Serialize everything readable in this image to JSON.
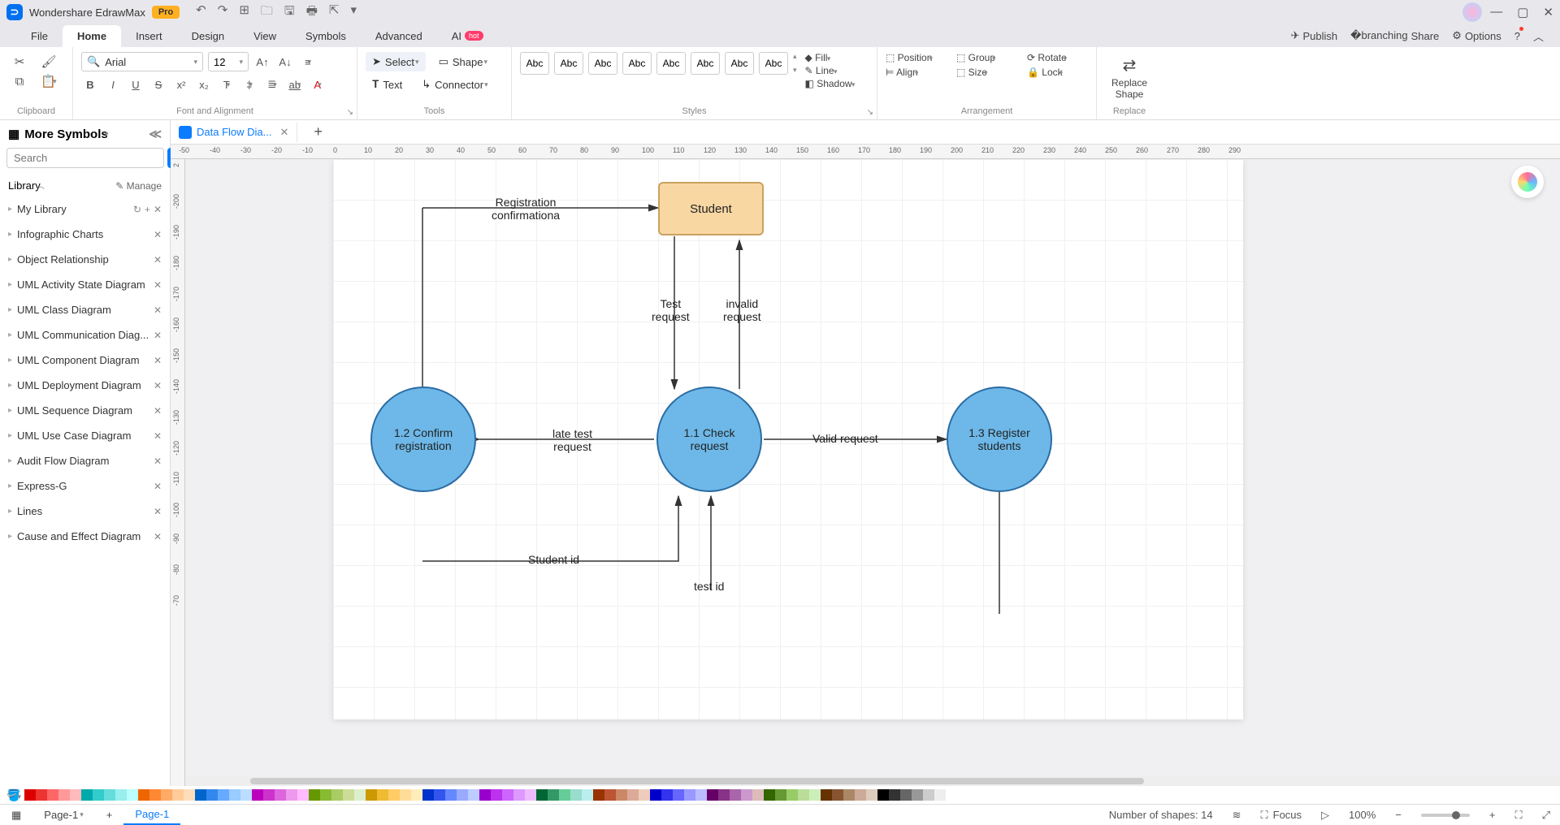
{
  "title": {
    "app": "Wondershare EdrawMax",
    "pro": "Pro"
  },
  "menu": {
    "tabs": [
      "File",
      "Home",
      "Insert",
      "Design",
      "View",
      "Symbols",
      "Advanced"
    ],
    "ai": "AI",
    "hot": "hot",
    "right": {
      "publish": "Publish",
      "share": "Share",
      "options": "Options"
    }
  },
  "ribbon": {
    "clipboard": "Clipboard",
    "font": {
      "name": "Arial",
      "size": "12",
      "label": "Font and Alignment"
    },
    "tools": {
      "select": "Select",
      "text": "Text",
      "shape": "Shape",
      "connector": "Connector",
      "label": "Tools"
    },
    "styles": {
      "sample": "Abc",
      "fill": "Fill",
      "line": "Line",
      "shadow": "Shadow",
      "label": "Styles"
    },
    "arrange": {
      "position": "Position",
      "align": "Align",
      "group": "Group",
      "size": "Size",
      "rotate": "Rotate",
      "lock": "Lock",
      "label": "Arrangement"
    },
    "replace": {
      "shape1": "Replace",
      "shape2": "Shape",
      "label": "Replace"
    }
  },
  "left": {
    "title": "More Symbols",
    "search_ph": "Search",
    "search_btn": "Search",
    "library": "Library",
    "manage": "Manage",
    "mylib": "My Library",
    "cats": [
      "Infographic Charts",
      "Object Relationship",
      "UML Activity State Diagram",
      "UML Class Diagram",
      "UML Communication Diag...",
      "UML Component Diagram",
      "UML Deployment Diagram",
      "UML Sequence Diagram",
      "UML Use Case Diagram",
      "Audit Flow Diagram",
      "Express-G",
      "Lines",
      "Cause and Effect Diagram"
    ]
  },
  "doc": {
    "tab": "Data Flow Dia..."
  },
  "ruler_h": [
    "-50",
    "-40",
    "-30",
    "-20",
    "-10",
    "0",
    "10",
    "20",
    "30",
    "40",
    "50",
    "60",
    "70",
    "80",
    "90",
    "100",
    "110",
    "120",
    "130",
    "140",
    "150",
    "160",
    "170",
    "180",
    "190",
    "200",
    "210",
    "220",
    "230",
    "240",
    "250",
    "260",
    "270",
    "280",
    "290"
  ],
  "ruler_v": [
    "2",
    "-200",
    "-190",
    "-180",
    "-170",
    "-160",
    "-150",
    "-140",
    "-130",
    "-120",
    "-110",
    "-100",
    "-90",
    "-80",
    "-70"
  ],
  "diagram": {
    "student": "Student",
    "reg_conf": "Registration\nconfirmationa",
    "test_req": "Test\nrequest",
    "invalid": "invalid\nrequest",
    "late": "late test\nrequest",
    "valid": "Valid request",
    "studid": "Student id",
    "testid": "test id",
    "p11": "1.1 Check\nrequest",
    "p12": "1.2 Confirm\nregistration",
    "p13": "1.3 Register\nstudents"
  },
  "colors": [
    "#d00",
    "#e33",
    "#f66",
    "#f99",
    "#fbb",
    "#0aa",
    "#3cc",
    "#6dd",
    "#9ee",
    "#bff",
    "#e60",
    "#f83",
    "#fa6",
    "#fc9",
    "#fdb",
    "#06c",
    "#38e",
    "#6af",
    "#9cf",
    "#bdf",
    "#b0b",
    "#c3c",
    "#d6d",
    "#e9e",
    "#fbf",
    "#690",
    "#8b3",
    "#ac6",
    "#cd9",
    "#dec",
    "#c90",
    "#eb3",
    "#fc6",
    "#fd9",
    "#feb",
    "#03c",
    "#35e",
    "#68f",
    "#9af",
    "#bcf",
    "#90c",
    "#b3e",
    "#c6f",
    "#d9f",
    "#ebf",
    "#063",
    "#396",
    "#6c9",
    "#9dc",
    "#bee",
    "#930",
    "#b53",
    "#c86",
    "#da9",
    "#ecb",
    "#00c",
    "#33e",
    "#66f",
    "#99f",
    "#bbf",
    "#606",
    "#838",
    "#a6a",
    "#c9c",
    "#dbb",
    "#360",
    "#693",
    "#9c6",
    "#bd9",
    "#ceb",
    "#630",
    "#853",
    "#a86",
    "#ca9",
    "#dcb",
    "#000",
    "#333",
    "#666",
    "#999",
    "#ccc",
    "#eee",
    "#fff"
  ],
  "footer": {
    "page": "Page-1",
    "page_cur": "Page-1",
    "shapes": "Number of shapes: 14",
    "focus": "Focus",
    "zoom": "100%"
  }
}
